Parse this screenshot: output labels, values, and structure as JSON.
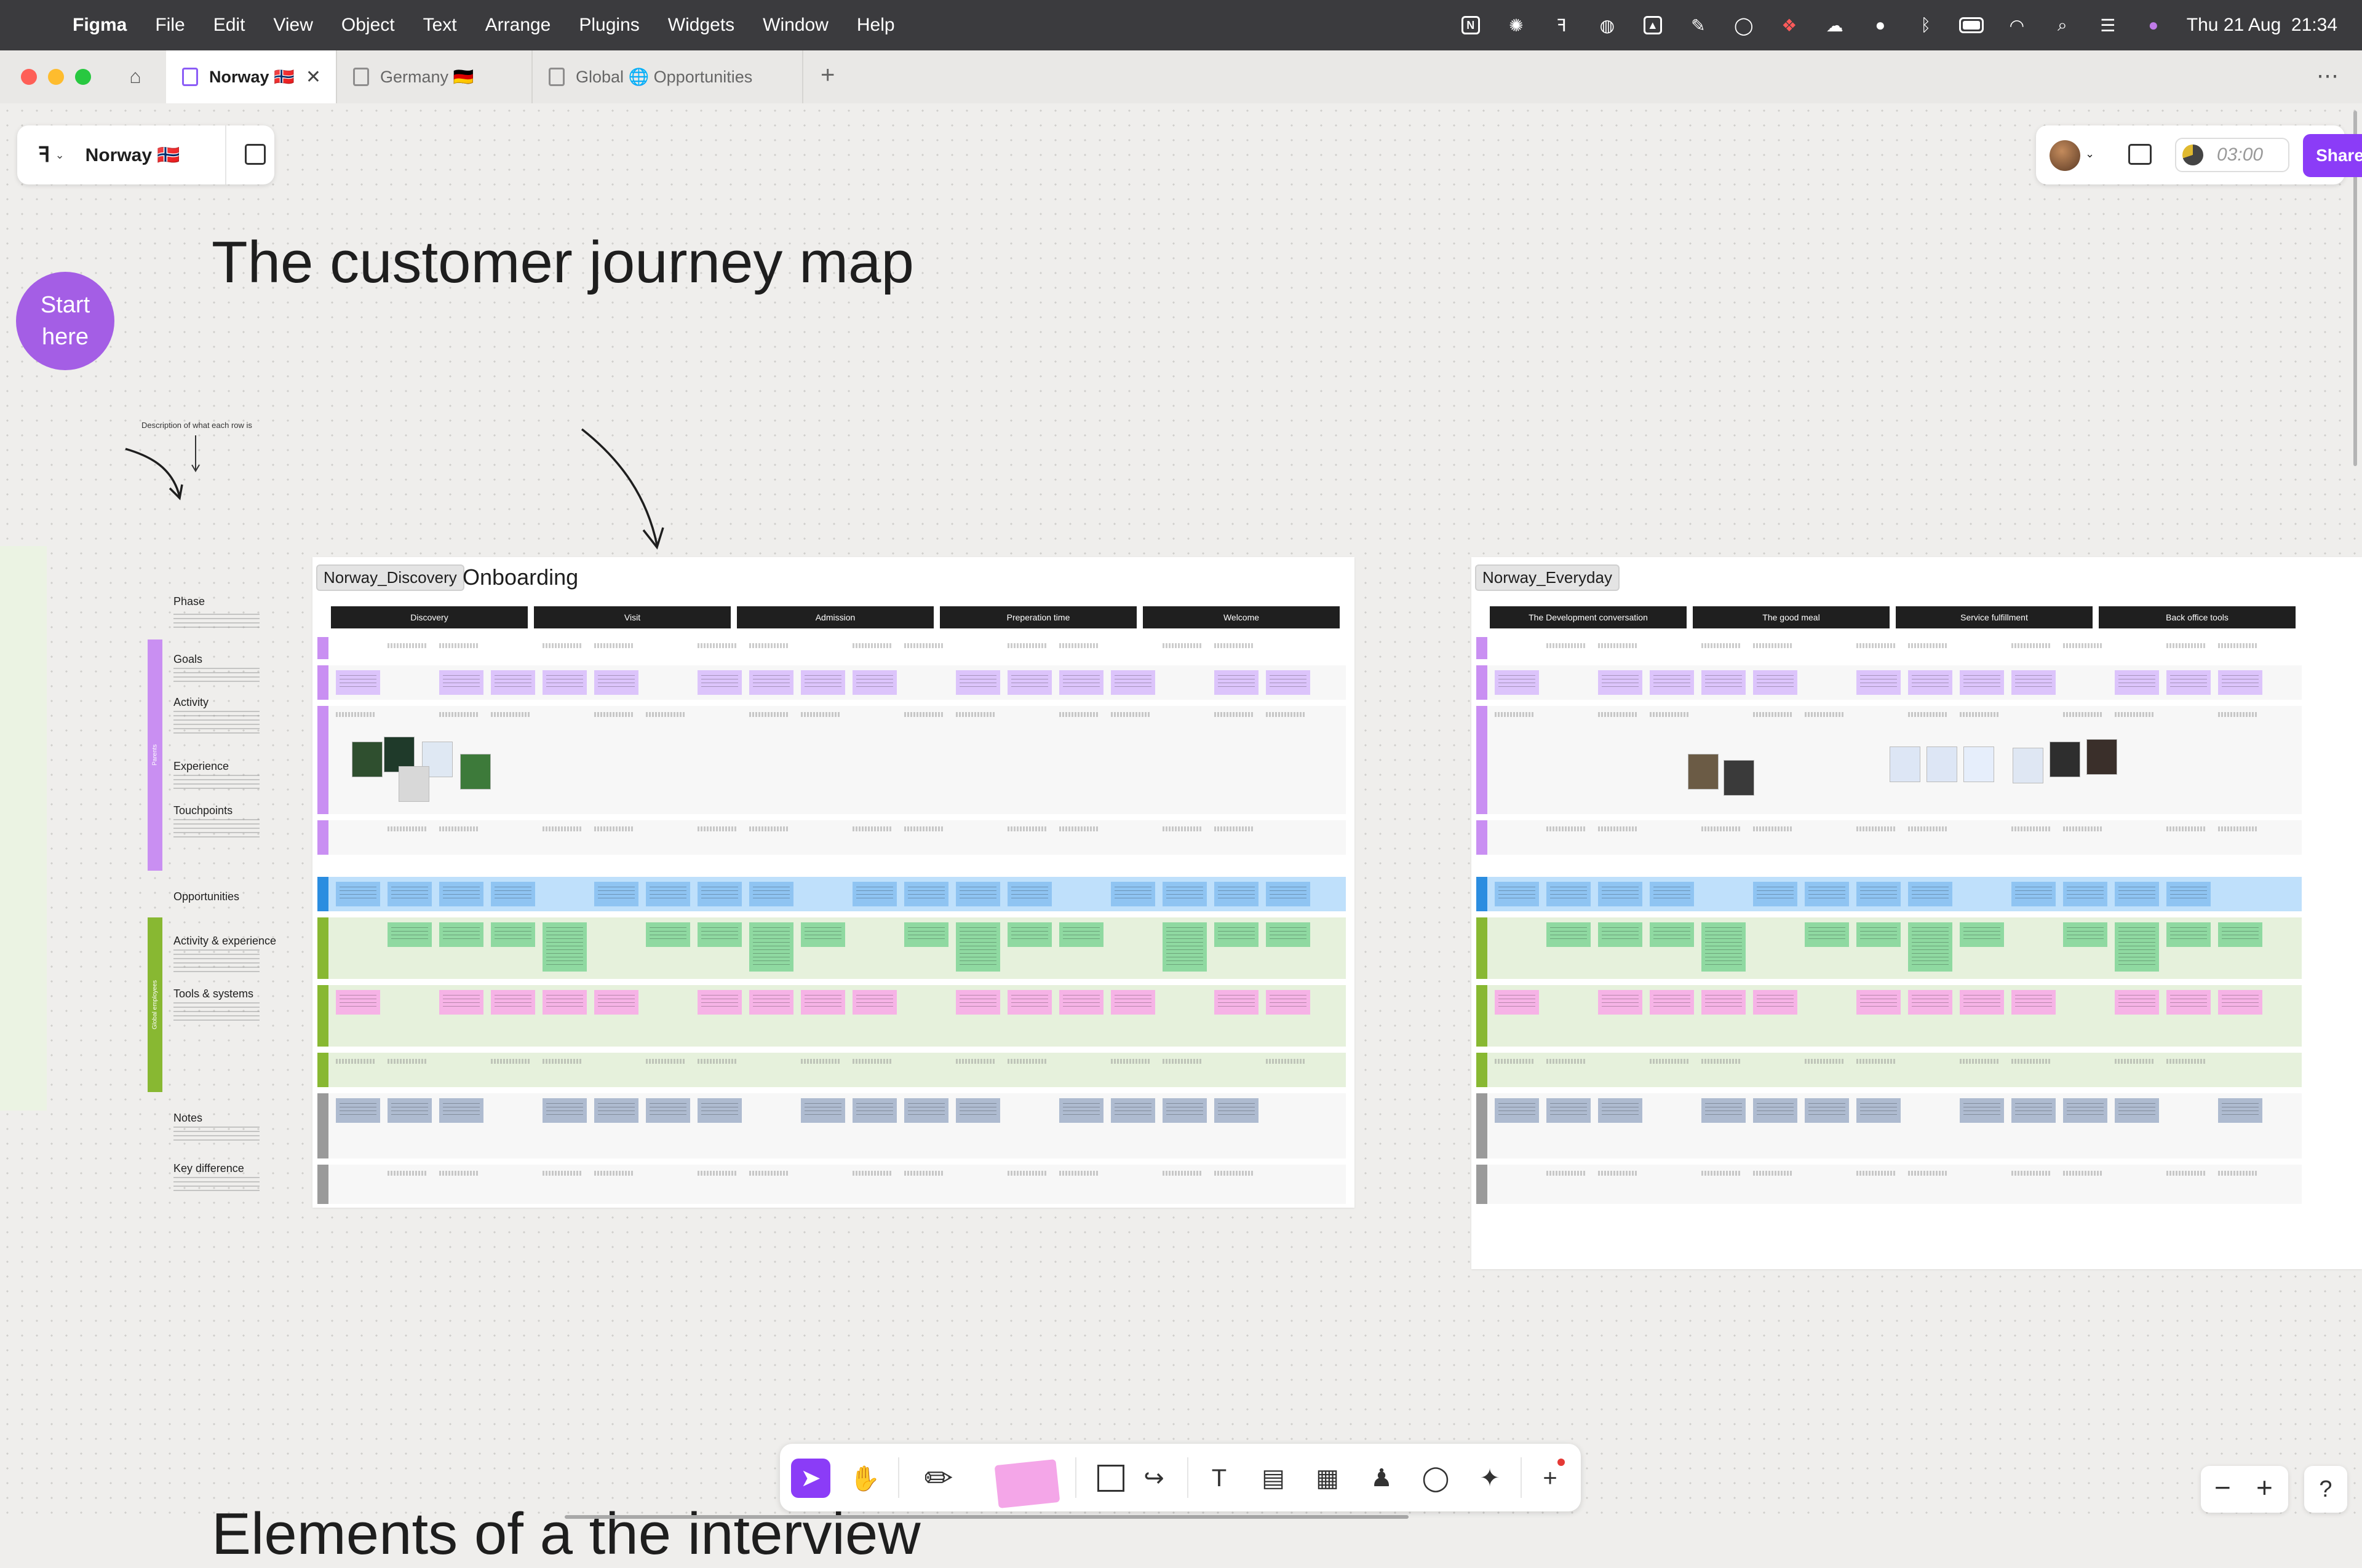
{
  "menubar": {
    "app": "Figma",
    "items": [
      "File",
      "Edit",
      "View",
      "Object",
      "Text",
      "Arrange",
      "Plugins",
      "Widgets",
      "Window",
      "Help"
    ],
    "datetime": "Thu 21 Aug  21:34",
    "status_icons": [
      "notion-icon",
      "chatgpt-icon",
      "figma-icon",
      "vpn-icon",
      "drive-icon",
      "pen-icon",
      "chat-icon",
      "dropbox-icon",
      "cloud-icon",
      "user-icon",
      "bluetooth-icon",
      "battery-icon",
      "wifi-icon",
      "search-icon",
      "control-center-icon",
      "siri-icon"
    ]
  },
  "tabs": [
    {
      "label": "Norway 🇳🇴",
      "active": true
    },
    {
      "label": "Germany 🇩🇪",
      "active": false
    },
    {
      "label": "Global 🌐 Opportunities",
      "active": false
    }
  ],
  "file": {
    "name": "Norway 🇳🇴"
  },
  "header_right": {
    "timer": "03:00",
    "share": "Share"
  },
  "canvas": {
    "title": "The customer journey map",
    "start_here": "Start here",
    "legend": {
      "description": "Description of what each row is",
      "rows": [
        "Phase",
        "Goals",
        "Activity",
        "Experience",
        "Touchpoints",
        "Opportunities",
        "Activity & experience",
        "Tools & systems",
        "Notes",
        "Key difference"
      ],
      "group_parents": "Parents",
      "group_employees": "Global employees"
    },
    "board1": {
      "label": "Norway_Discovery",
      "title": "Onboarding",
      "phases": [
        "Discovery",
        "Visit",
        "Admission",
        "Preperation time",
        "Welcome"
      ]
    },
    "board2": {
      "label": "Norway_Everyday",
      "phases": [
        "The Development conversation",
        "The good meal",
        "Service fulfillment",
        "Back office tools"
      ]
    },
    "bottom_text": "Elements of a the interview"
  },
  "toolbar": {
    "tools": [
      "move-icon",
      "hand-icon",
      "pen-icon",
      "sticky-icon",
      "shape-icon",
      "connector-icon",
      "text-icon",
      "section-icon",
      "table-icon",
      "stamp-icon",
      "comment-icon",
      "ai-icon",
      "more-icon"
    ]
  },
  "colors": {
    "accent": "#8b3cf7",
    "start_circle": "#a45ee5",
    "sticky_purple": "#dcc4fb",
    "sticky_blue": "#8fc4f2",
    "sticky_green": "#8fd9a1",
    "sticky_pink": "#f6b3e6",
    "sticky_gray": "#aebbd0",
    "row_blue": "#bfe0fb",
    "row_green": "#e6f1dc"
  }
}
